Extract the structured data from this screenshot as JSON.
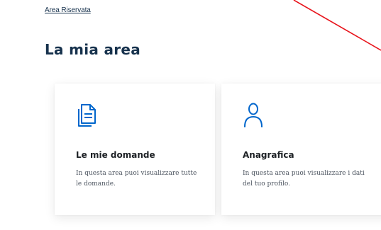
{
  "breadcrumb": {
    "label": "Area Riservata"
  },
  "page_title": "La mia area",
  "cards": [
    {
      "id": "domande",
      "icon": "document-icon",
      "title": "Le mie domande",
      "description": "In questa area puoi visualizzare tutte le domande."
    },
    {
      "id": "anagrafica",
      "icon": "user-profile-icon",
      "title": "Anagrafica",
      "description": "In questa area puoi visualizzare i dati del tuo profilo."
    }
  ],
  "colors": {
    "primary": "#0066cc",
    "heading": "#17324d",
    "annotation": "#e8141c"
  }
}
